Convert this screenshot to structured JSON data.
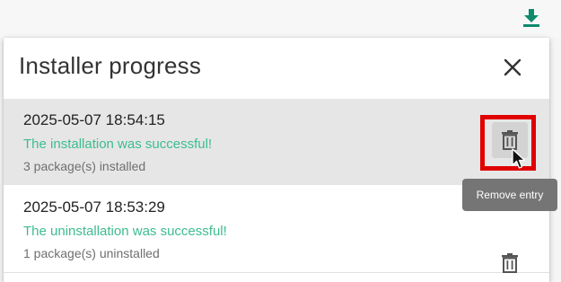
{
  "panel": {
    "title": "Installer progress"
  },
  "entries": [
    {
      "date": "2025-05-07 18:54:15",
      "status": "The installation was successful!",
      "count": "3 package(s) installed"
    },
    {
      "date": "2025-05-07 18:53:29",
      "status": "The uninstallation was successful!",
      "count": "1 package(s) uninstalled"
    }
  ],
  "tooltip": {
    "text": "Remove entry"
  },
  "colors": {
    "accent": "#0f8a6c",
    "success_text": "#3dbd8e",
    "highlight": "#e00000",
    "tooltip_bg": "#757575"
  },
  "icons": {
    "download": "download-icon",
    "close": "close-icon",
    "remove": "trash-icon",
    "cursor": "mouse-pointer-icon"
  }
}
